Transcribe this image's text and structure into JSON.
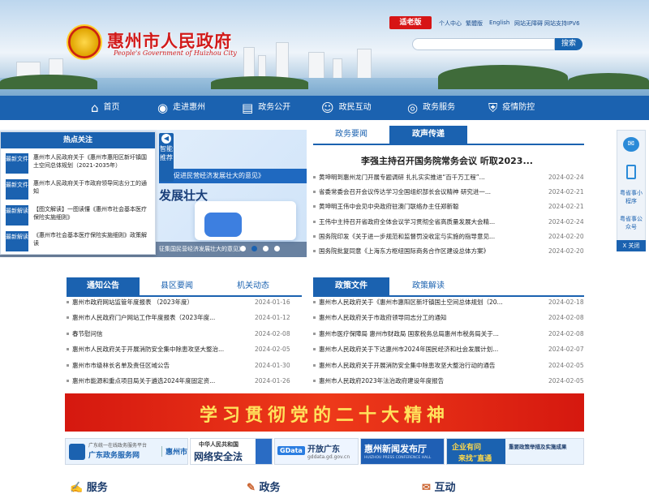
{
  "header": {
    "site_title": "惠州市人民政府",
    "site_subtitle": "People's Government of Huizhou City",
    "elder_mode": "适老版",
    "top_links": [
      "个人中心",
      "繁體版",
      "English",
      "网站无障碍",
      "网站支持IPV6"
    ],
    "search_button": "搜索",
    "search_placeholder": ""
  },
  "nav": [
    "首页",
    "走进惠州",
    "政务公开",
    "政民互动",
    "政务服务",
    "疫情防控"
  ],
  "hot": {
    "title": "热点关注",
    "items": [
      {
        "tag": "最新文件",
        "text": "惠州市人民政府关于《惠州市惠阳区新圩镇国土空间总体规划（2021-2035年）"
      },
      {
        "tag": "最新文件",
        "text": "惠州市人民政府关于市政府领导同志分工的通知"
      },
      {
        "tag": "最新解读",
        "text": "【图文解读】一图读懂《惠州市社会基本医疗保险实施细则》"
      },
      {
        "tag": "最新解读",
        "text": "《惠州市社会基本医疗保险实施细则》政策解读"
      }
    ]
  },
  "smart": "智能推荐",
  "banner": {
    "strip": "关于促进民营经济发展壮大的意见》",
    "big": "发展壮大",
    "caption": "征集国民营经济发展壮大的意见》"
  },
  "news": {
    "tabs": [
      "政务要闻",
      "政声传递"
    ],
    "headline": "李强主持召开国务院常务会议 听取2023...",
    "items": [
      {
        "title": "黄坤明到惠州龙门开展专题调研 扎扎实实推进“百千万工程”...",
        "date": "2024-02-24"
      },
      {
        "title": "省委常委会召开会议传达学习全国组织部长会议精神 研究进一...",
        "date": "2024-02-21"
      },
      {
        "title": "黄坤明王伟中会见中央政府驻澳门联络办主任郑新聪",
        "date": "2024-02-21"
      },
      {
        "title": "王伟中主持召开省政府全体会议学习贯彻全省高质量发展大会精...",
        "date": "2024-02-24"
      },
      {
        "title": "国务院印发《关于进一步规范和监督罚没收定与实施的指导意见...",
        "date": "2024-02-20"
      },
      {
        "title": "国务院批复同意《上海东方枢纽国际商务合作区建设总体方案》",
        "date": "2024-02-20"
      }
    ]
  },
  "notice": {
    "tabs": [
      "通知公告",
      "县区要闻",
      "机关动态"
    ],
    "items": [
      {
        "title": "惠州市政府网站监管年度报表 （2023年度）",
        "date": "2024-01-16"
      },
      {
        "title": "惠州市人民政府门户网站工作年度报表（2023年度...",
        "date": "2024-01-12"
      },
      {
        "title": "春节慰问信",
        "date": "2024-02-08"
      },
      {
        "title": "惠州市人民政府关于开展消防安全集中除患攻坚大整治...",
        "date": "2024-02-05"
      },
      {
        "title": "惠州市市级林长名单及责任区域公告",
        "date": "2024-01-30"
      },
      {
        "title": "惠州市能源和重点项目局关于遴选2024年度固定资...",
        "date": "2024-01-26"
      }
    ]
  },
  "policy": {
    "tabs": [
      "政策文件",
      "政策解读"
    ],
    "items": [
      {
        "title": "惠州市人民政府关于《惠州市惠阳区新圩镇国土空间总体规划（20...",
        "date": "2024-02-18"
      },
      {
        "title": "惠州市人民政府关于市政府领导同志分工的通知",
        "date": "2024-02-08"
      },
      {
        "title": "惠州市医疗保障局 惠州市财政局 国家税务总局惠州市税务局关于...",
        "date": "2024-02-08"
      },
      {
        "title": "惠州市人民政府关于下达惠州市2024年国民经济和社会发展计划...",
        "date": "2024-02-07"
      },
      {
        "title": "惠州市人民政府关于开展消防安全集中除患攻坚大整治行动的通告",
        "date": "2024-02-05"
      },
      {
        "title": "惠州市人民政府2023年法治政府建设年度报告",
        "date": "2024-02-05"
      }
    ]
  },
  "side_tools": [
    "粤省事小程序",
    "粤省事公众号",
    "X 关闭"
  ],
  "party_banner": "学习贯彻党的二十大精神",
  "tiles": {
    "gd_service_small": "广东统一在线政务服务平台",
    "gd_service": "广东政务服务网",
    "gd_city": "惠州市",
    "law_top": "中华人民共和国",
    "law_main": "网络安全法",
    "gdata": "GData",
    "open_gd": "开放广东",
    "open_gd_url": "gddata.gd.gov.cn",
    "press": "惠州新闻发布厅",
    "press_en": "HUIZHOU PRESS CONFERENCE HALL",
    "ent_a": "企业有问",
    "ent_b": "来找“直通",
    "ent_small": "重要政策举措及实施成果"
  },
  "bottom_labels": [
    "服务",
    "政务",
    "互动"
  ],
  "colors": {
    "primary": "#1b62b0",
    "red": "#d71515",
    "gold": "#ffe25c"
  }
}
